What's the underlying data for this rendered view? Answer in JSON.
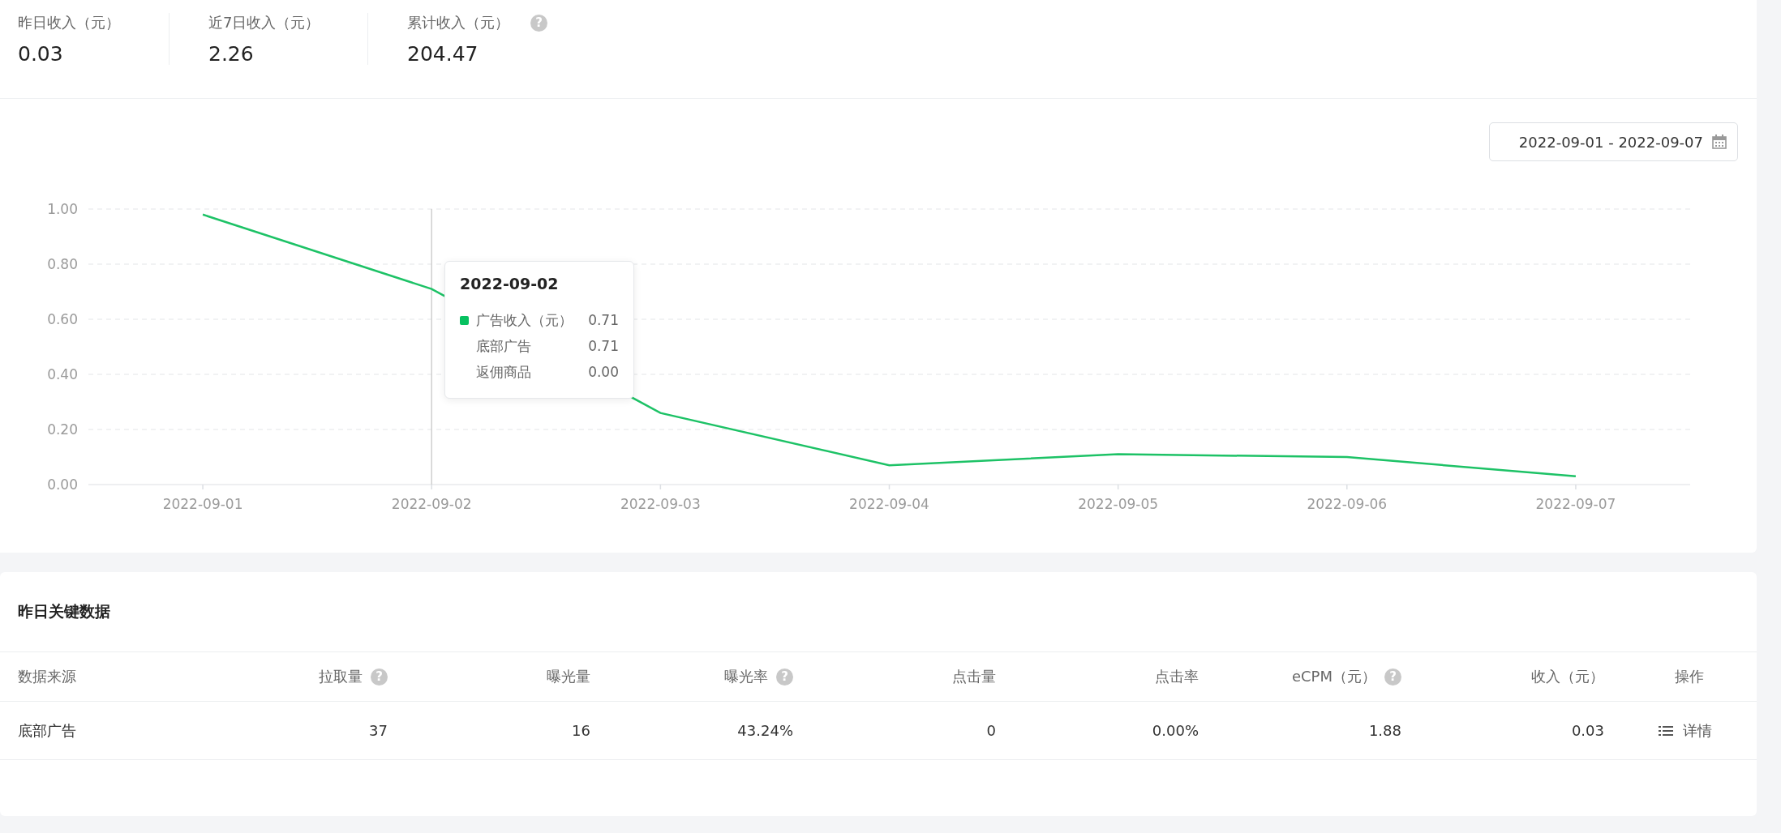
{
  "stats": [
    {
      "label": "昨日收入（元）",
      "value": "0.03"
    },
    {
      "label": "近7日收入（元）",
      "value": "2.26"
    },
    {
      "label": "累计收入（元）",
      "value": "204.47",
      "help": "?"
    }
  ],
  "date_range": {
    "value": "2022-09-01 - 2022-09-07"
  },
  "chart": {
    "chart_data": {
      "type": "line",
      "categories": [
        "2022-09-01",
        "2022-09-02",
        "2022-09-03",
        "2022-09-04",
        "2022-09-05",
        "2022-09-06",
        "2022-09-07"
      ],
      "series": [
        {
          "color": "#1dc266",
          "values": [
            0.98,
            0.71,
            0.26,
            0.07,
            0.11,
            0.1,
            0.03
          ]
        }
      ],
      "grid": true,
      "ref_lines": [
        {
          "axis": "x",
          "value": "2022-09-02",
          "color": "#cfcfcf"
        }
      ],
      "ylim": [
        0,
        1
      ],
      "yticks": [
        {
          "value": 0,
          "label": "0.00"
        },
        {
          "value": 0.2,
          "label": "0.20"
        },
        {
          "value": 0.4,
          "label": "0.40"
        },
        {
          "value": 0.6,
          "label": "0.60"
        },
        {
          "value": 0.8,
          "label": "0.80"
        },
        {
          "value": 1,
          "label": "1.00"
        }
      ]
    },
    "tooltip": {
      "title": "2022-09-02",
      "rows": [
        {
          "label": "广告收入（元）",
          "value": "0.71",
          "color": "#07c160"
        },
        {
          "label": "底部广告",
          "value": "0.71"
        },
        {
          "label": "返佣商品",
          "value": "0.00"
        }
      ]
    }
  },
  "key_data": {
    "title": "昨日关键数据",
    "columns": [
      {
        "label": "数据来源"
      },
      {
        "label": "拉取量",
        "help": "?"
      },
      {
        "label": "曝光量"
      },
      {
        "label": "曝光率",
        "help": "?"
      },
      {
        "label": "点击量"
      },
      {
        "label": "点击率"
      },
      {
        "label": "eCPM（元）",
        "help": "?"
      },
      {
        "label": "收入（元）"
      },
      {
        "label": "操作"
      }
    ],
    "rows": [
      {
        "cells": [
          "底部广告",
          "37",
          "16",
          "43.24%",
          "0",
          "0.00%",
          "1.88",
          "0.03"
        ],
        "action": "详情"
      }
    ]
  }
}
